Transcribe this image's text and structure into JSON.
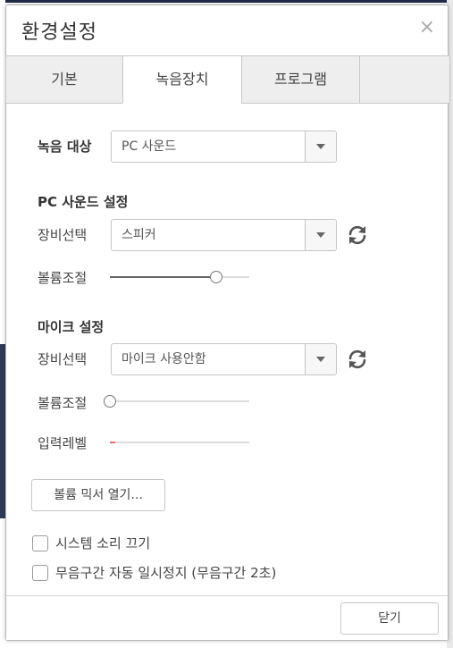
{
  "dialog": {
    "title": "환경설정",
    "close_glyph": "×"
  },
  "tabs": [
    {
      "label": "기본"
    },
    {
      "label": "녹음장치"
    },
    {
      "label": "프로그램"
    },
    {
      "label": ""
    }
  ],
  "active_tab": 1,
  "record_target": {
    "label": "녹음 대상",
    "value": "PC 사운드"
  },
  "pc_sound": {
    "heading": "PC 사운드 설정",
    "device_label": "장비선택",
    "device_value": "스피커",
    "volume_label": "볼륨조절",
    "volume_fraction": 0.76
  },
  "mic": {
    "heading": "마이크 설정",
    "device_label": "장비선택",
    "device_value": "마이크 사용안함",
    "volume_label": "볼륨조절",
    "volume_fraction": 0.0,
    "level_label": "입력레벨",
    "level_fraction": 0.04
  },
  "mixer_button": "볼륨 믹서 열기...",
  "options": [
    {
      "label": "시스템 소리 끄기",
      "checked": false
    },
    {
      "label": "무음구간 자동 일시정지 (무음구간 2초)",
      "checked": false
    }
  ],
  "footer": {
    "close_button": "닫기"
  },
  "colors": {
    "level_fill": "#e57373",
    "slider_fill": "#666666",
    "tab_inactive": "#eeeeee"
  },
  "icons": {
    "refresh": "refresh-icon",
    "dropdown": "chevron-down-icon",
    "close": "close-icon"
  }
}
